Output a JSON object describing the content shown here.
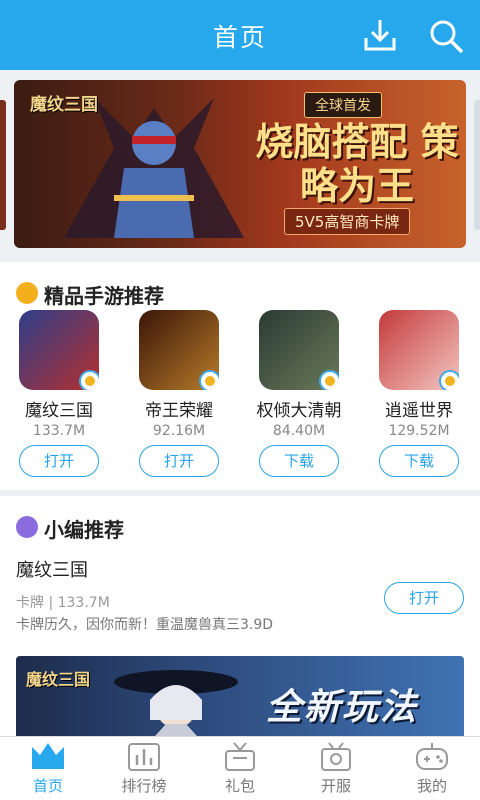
{
  "header": {
    "title": "首页",
    "download_icon": "download-icon",
    "search_icon": "search-icon",
    "bg_color": "#27a8ec"
  },
  "banner": {
    "logo": "魔纹三国",
    "tag": "全球首发",
    "headline": "烧脑搭配 策略为王",
    "subtitle": "5V5高智商卡牌"
  },
  "featured": {
    "title": "精品手游推荐",
    "games": [
      {
        "name": "魔纹三国",
        "size": "133.7M",
        "action": "打开"
      },
      {
        "name": "帝王荣耀",
        "size": "92.16M",
        "action": "打开"
      },
      {
        "name": "权倾大清朝",
        "size": "84.40M",
        "action": "下载"
      },
      {
        "name": "逍遥世界",
        "size": "129.52M",
        "action": "下载"
      }
    ]
  },
  "editor_pick": {
    "title": "小编推荐",
    "game_name": "魔纹三国",
    "meta": "卡牌 | 133.7M",
    "description": "卡牌历久，因你而新！重温魔兽真三3.9D",
    "action": "打开",
    "banner_logo": "魔纹三国",
    "banner_text": "全新玩法"
  },
  "bottom_nav": {
    "items": [
      {
        "label": "首页",
        "icon": "home-crown-icon",
        "active": true
      },
      {
        "label": "排行榜",
        "icon": "ranking-icon",
        "active": false
      },
      {
        "label": "礼包",
        "icon": "gift-tv-icon",
        "active": false
      },
      {
        "label": "开服",
        "icon": "server-open-icon",
        "active": false
      },
      {
        "label": "我的",
        "icon": "gamepad-icon",
        "active": false
      }
    ]
  }
}
